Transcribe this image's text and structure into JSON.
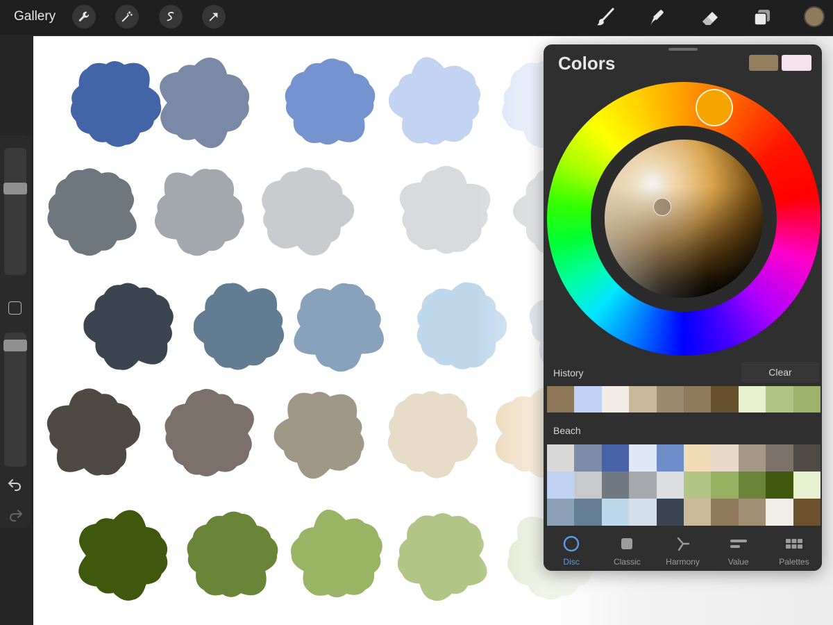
{
  "topbar": {
    "gallery_label": "Gallery",
    "left_tools": [
      "wrench-icon",
      "magic-wand-icon",
      "selection-icon",
      "transform-arrow-icon"
    ],
    "right_tools": [
      "brush-icon",
      "smudge-icon",
      "eraser-icon",
      "layers-icon"
    ],
    "current_color": "#8f7a5d"
  },
  "sidebar": {
    "items": [
      "brush-size-slider",
      "modify-button",
      "brush-opacity-slider",
      "undo-icon",
      "redo-icon"
    ]
  },
  "canvas": {
    "blob_rows": [
      [
        "#4464a8",
        "#7a8aa6",
        "#7594cf",
        "#c2d4f2",
        "#d5e2f5"
      ],
      [
        "#6e767e",
        "#a3a8ae",
        "#c9cbcf",
        "#d8dadd",
        "#c9cbce"
      ],
      [
        "#3a4550",
        "#627c92",
        "#88a2bc",
        "#bfd8ec",
        "#c4d4e0"
      ],
      [
        "#4f4944",
        "#7b716a",
        "#a09886",
        "#e7dcc8",
        "#ecd6b6"
      ],
      [
        "#3f580e",
        "#6a8438",
        "#9ab466",
        "#b1c586",
        "#dde4c8"
      ]
    ]
  },
  "colors_panel": {
    "title": "Colors",
    "primary_color": "#957e5e",
    "secondary_color": "#f5e1ec",
    "history_label": "History",
    "clear_label": "Clear",
    "history": [
      "#8d7758",
      "#c0d2f5",
      "#f1ece6",
      "#c9b89d",
      "#9c8a6e",
      "#8f7a5c",
      "#66502e",
      "#e7f0cf",
      "#b0c686",
      "#9db26b"
    ],
    "palette_name": "Beach",
    "palette": [
      "#d8d8d8",
      "#7d8ba8",
      "#4762a6",
      "#dfe8f9",
      "#6f8ec9",
      "#f1dbb6",
      "#e6d9c8",
      "#a49986",
      "#7b736a",
      "#4f4a44",
      "#c1d1f1",
      "#c7c9cd",
      "#707981",
      "#a5a9ad",
      "#dcdee1",
      "#b1c586",
      "#96b062",
      "#6a8438",
      "#3f580e",
      "#e6f1cf",
      "#8ca0b6",
      "#667e94",
      "#bfd9ec",
      "#d3e0ea",
      "#3b4450",
      "#cbb99c",
      "#8f7a5c",
      "#a08f74",
      "#f1ede8",
      "#6c522e"
    ],
    "tabs": [
      {
        "label": "Disc",
        "icon": "disc-icon"
      },
      {
        "label": "Classic",
        "icon": "classic-square-icon"
      },
      {
        "label": "Harmony",
        "icon": "harmony-icon"
      },
      {
        "label": "Value",
        "icon": "value-sliders-icon"
      },
      {
        "label": "Palettes",
        "icon": "palettes-grid-icon"
      }
    ],
    "active_tab": "Disc"
  }
}
